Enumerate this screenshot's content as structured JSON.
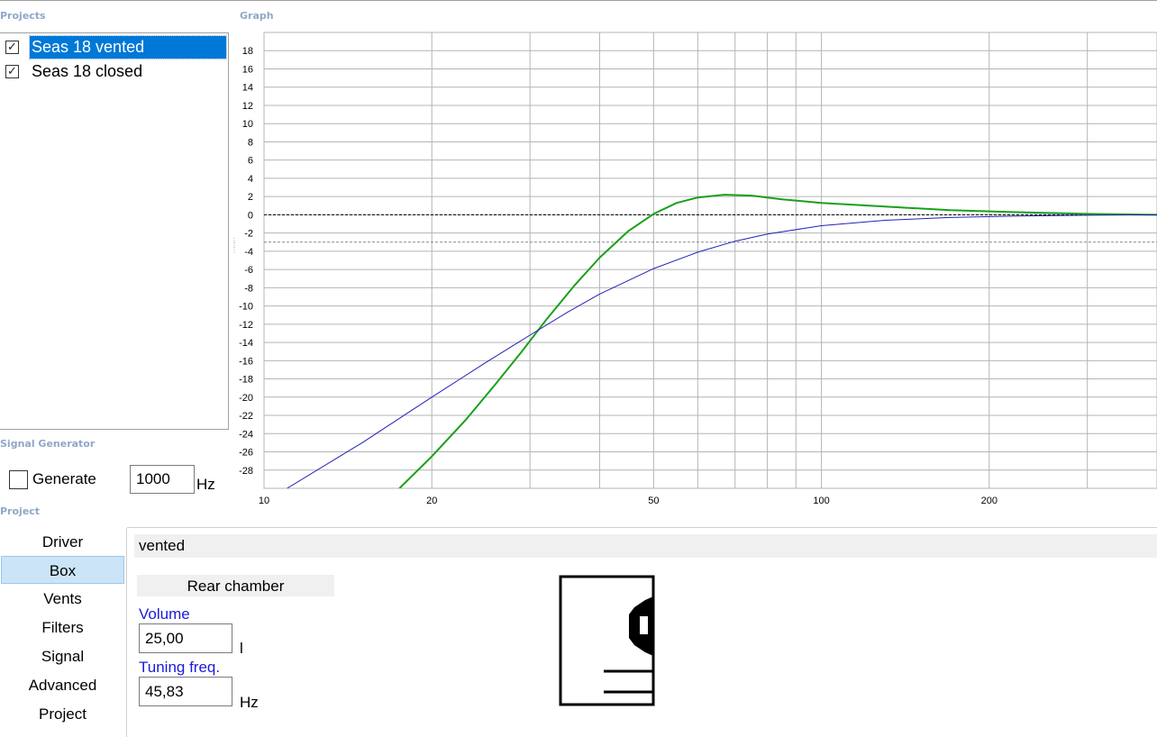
{
  "projects": {
    "label": "Projects",
    "items": [
      {
        "label": "Seas 18 vented",
        "checked": true,
        "selected": true
      },
      {
        "label": "Seas 18 closed",
        "checked": true,
        "selected": false
      }
    ]
  },
  "graph": {
    "label": "Graph",
    "chart_data": {
      "type": "line",
      "x_scale": "log",
      "xlim": [
        10,
        400
      ],
      "ylim": [
        -30,
        20
      ],
      "x_ticks": [
        "10",
        "20",
        "50",
        "100",
        "200"
      ],
      "y_ticks": [
        "18",
        "16",
        "14",
        "12",
        "10",
        "8",
        "6",
        "4",
        "2",
        "0",
        "-2",
        "-4",
        "-6",
        "-8",
        "-10",
        "-12",
        "-14",
        "-16",
        "-18",
        "-20",
        "-22",
        "-24",
        "-26",
        "-28"
      ],
      "grid": true,
      "reference_lines": [
        {
          "y": 0,
          "style": "dashed",
          "color": "#000000"
        },
        {
          "y": -3,
          "style": "dashed",
          "color": "#888888"
        }
      ],
      "series": [
        {
          "color": "#1aa01a",
          "x": [
            17.5,
            20,
            23,
            26,
            29,
            32,
            36,
            40,
            45,
            50,
            55,
            60,
            67,
            75,
            85,
            100,
            130,
            170,
            220,
            300,
            400
          ],
          "y": [
            -30,
            -26.5,
            -22.5,
            -18.6,
            -15,
            -11.6,
            -7.8,
            -4.7,
            -1.8,
            0.1,
            1.3,
            1.9,
            2.2,
            2.1,
            1.7,
            1.3,
            0.9,
            0.5,
            0.3,
            0.1,
            0
          ]
        },
        {
          "color": "#2020b8",
          "x": [
            11,
            15,
            20,
            25,
            30,
            35,
            40,
            50,
            60,
            70,
            80,
            100,
            130,
            170,
            220,
            300,
            400
          ],
          "y": [
            -30,
            -25,
            -20,
            -16.2,
            -13.2,
            -10.7,
            -8.7,
            -5.9,
            -4.1,
            -2.9,
            -2.1,
            -1.2,
            -0.6,
            -0.3,
            -0.15,
            -0.05,
            0
          ]
        }
      ]
    }
  },
  "signal_generator": {
    "label": "Signal Generator",
    "generate_label": "Generate",
    "generate_checked": false,
    "frequency": "1000",
    "unit": "Hz"
  },
  "project": {
    "label": "Project",
    "nav": [
      "Driver",
      "Box",
      "Vents",
      "Filters",
      "Signal",
      "Advanced",
      "Project"
    ],
    "active_nav": "Box",
    "box_type": "vented",
    "rear_chamber": {
      "title": "Rear chamber",
      "volume_label": "Volume",
      "volume_value": "25,00",
      "volume_unit": "l",
      "tuning_label": "Tuning freq.",
      "tuning_value": "45,83",
      "tuning_unit": "Hz"
    }
  },
  "icons": {
    "checkmark": "check-icon",
    "splitter": "splitter-grip-icon",
    "box": "vented-box-diagram-icon"
  }
}
